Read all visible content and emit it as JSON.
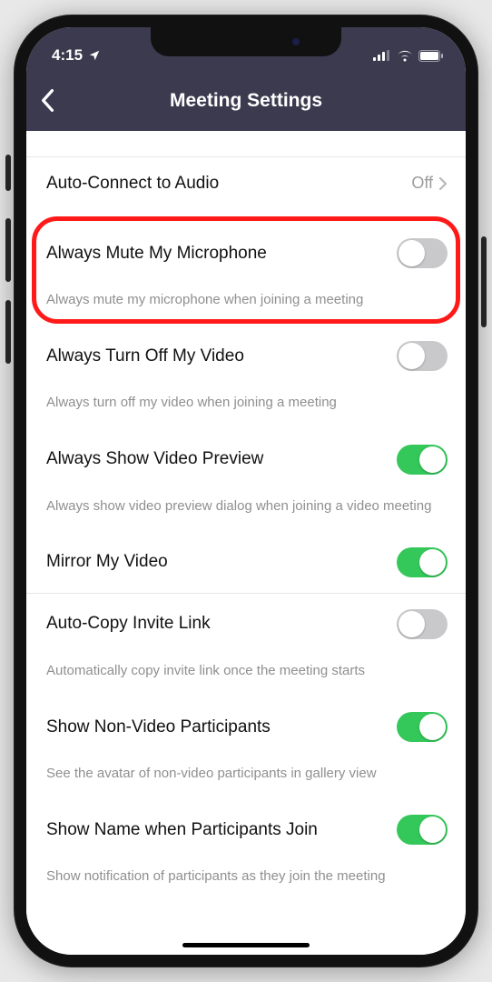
{
  "status": {
    "time": "4:15",
    "locationIcon": "location-arrow",
    "signal": "signal-3",
    "wifi": "wifi",
    "battery": "battery-full"
  },
  "header": {
    "title": "Meeting Settings",
    "backIcon": "chevron-left"
  },
  "rows": {
    "audio": {
      "label": "Auto-Connect to Audio",
      "value": "Off"
    },
    "muteMic": {
      "label": "Always Mute My Microphone",
      "desc": "Always mute my microphone when joining a meeting",
      "on": false
    },
    "turnOffVideo": {
      "label": "Always Turn Off My Video",
      "desc": "Always turn off my video when joining a meeting",
      "on": false
    },
    "showPreview": {
      "label": "Always Show Video Preview",
      "desc": "Always show video preview dialog when joining a video meeting",
      "on": true
    },
    "mirror": {
      "label": "Mirror My Video",
      "on": true
    },
    "autoCopy": {
      "label": "Auto-Copy Invite Link",
      "desc": "Automatically copy invite link once the meeting starts",
      "on": false
    },
    "nonVideo": {
      "label": "Show Non-Video Participants",
      "desc": "See the avatar of non-video participants in gallery view",
      "on": true
    },
    "showName": {
      "label": "Show Name when Participants Join",
      "desc": "Show notification of participants as they join the meeting",
      "on": true
    }
  },
  "highlight": {
    "show": true
  }
}
